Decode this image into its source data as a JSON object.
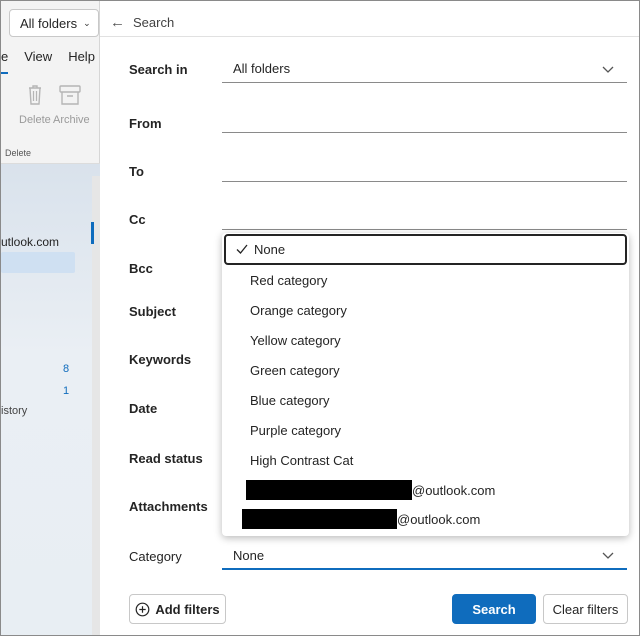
{
  "left": {
    "folder_button": "All folders",
    "tabs": [
      "e",
      "View",
      "Help"
    ],
    "toolbar": {
      "delete": "Delete",
      "archive": "Archive",
      "group": "Delete"
    },
    "account": "utlook.com",
    "counts": [
      "8",
      "1"
    ],
    "history": "istory"
  },
  "search_header": {
    "title": "Search"
  },
  "form": {
    "search_in": {
      "label": "Search in",
      "value": "All folders"
    },
    "from": {
      "label": "From"
    },
    "to": {
      "label": "To"
    },
    "cc": {
      "label": "Cc"
    },
    "bcc": {
      "label": "Bcc"
    },
    "subject": {
      "label": "Subject"
    },
    "keywords": {
      "label": "Keywords"
    },
    "date": {
      "label": "Date"
    },
    "read_status": {
      "label": "Read status"
    },
    "attachments": {
      "label": "Attachments"
    },
    "category": {
      "label": "Category",
      "value": "None"
    }
  },
  "dropdown": {
    "options": [
      "None",
      "Red category",
      "Orange category",
      "Yellow category",
      "Green category",
      "Blue category",
      "Purple category",
      "High Contrast Cat",
      "@outlook.com",
      "@outlook.com"
    ]
  },
  "footer": {
    "add_filters": "Add filters",
    "search": "Search",
    "clear_filters": "Clear filters"
  },
  "colors": {
    "accent": "#0f6cbd"
  }
}
